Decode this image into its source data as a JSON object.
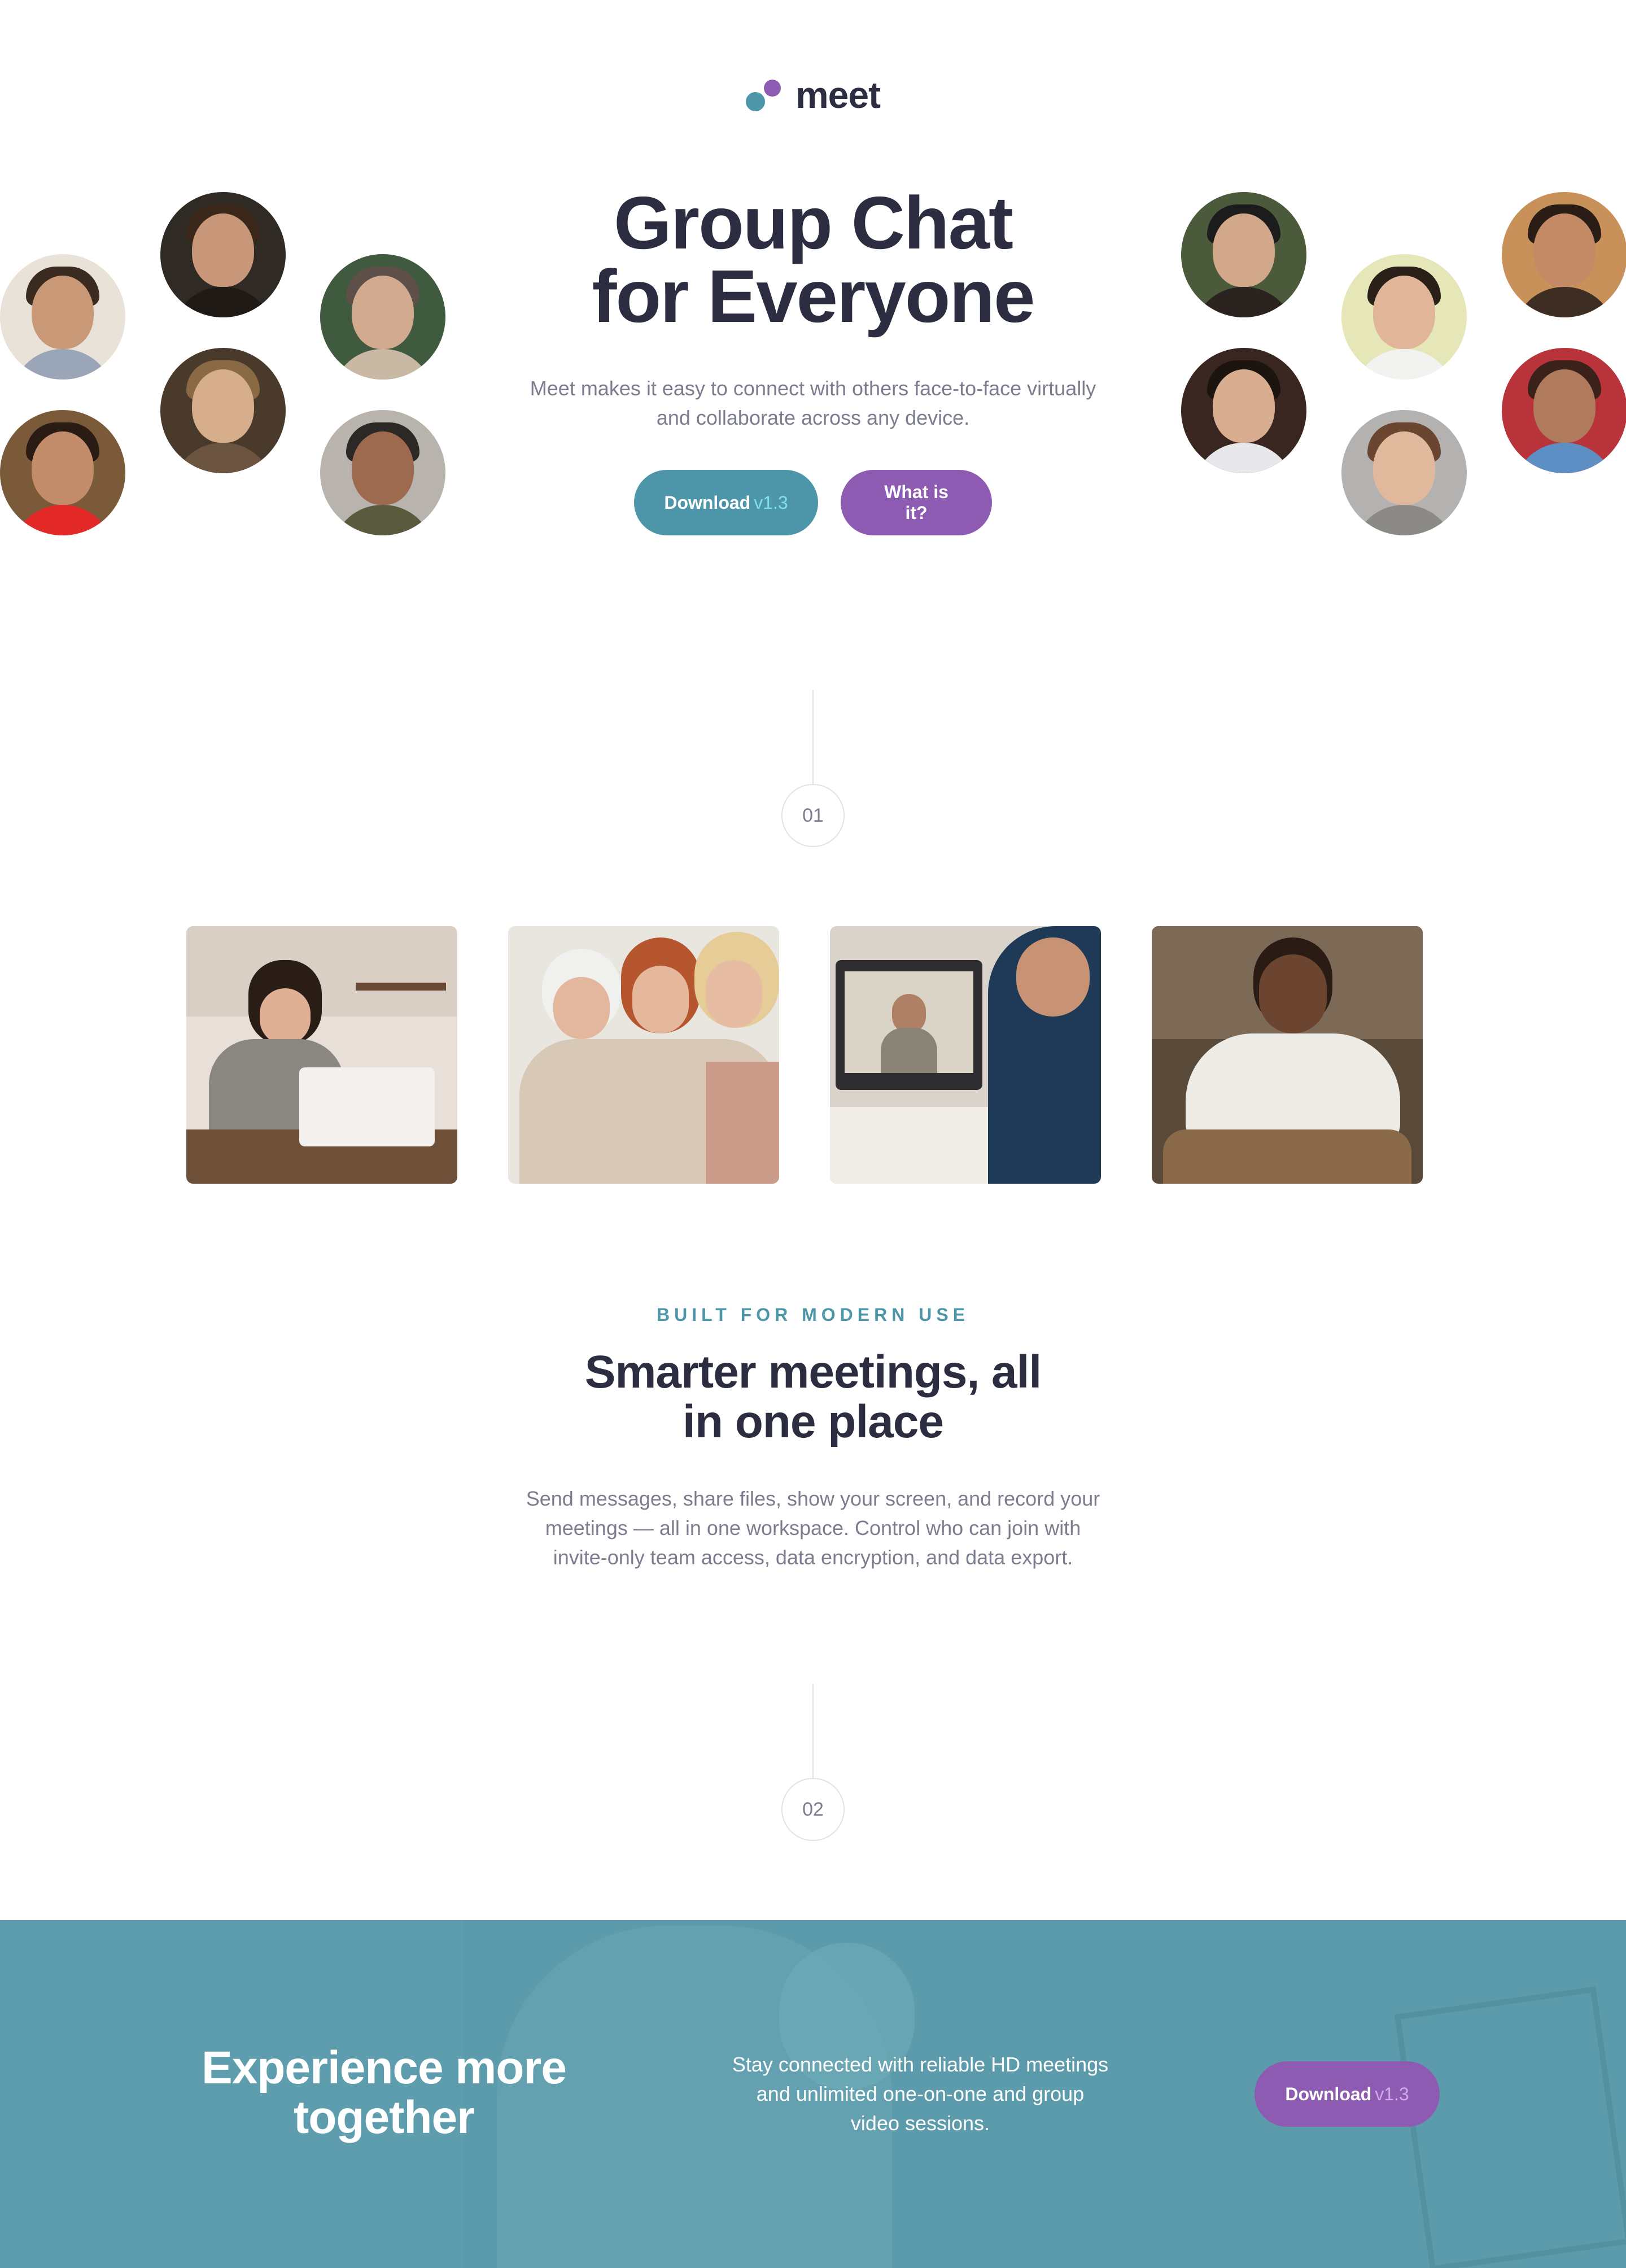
{
  "brand": {
    "name": "meet"
  },
  "hero": {
    "title_line1": "Group Chat",
    "title_line2": "for Everyone",
    "subtitle_line1": "Meet makes it easy to connect with others face-to-face virtually",
    "subtitle_line2": "and collaborate across any device.",
    "download_label": "Download",
    "download_version": "v1.3",
    "what_label": "What is it?"
  },
  "steps": {
    "first": "01",
    "second": "02"
  },
  "feature": {
    "eyebrow": "BUILT FOR MODERN USE",
    "title_line1": "Smarter meetings, all",
    "title_line2": "in one place",
    "body_line1": "Send messages, share files, show your screen, and record your",
    "body_line2": "meetings — all in one workspace. Control who can join with",
    "body_line3": "invite-only team access, data encryption, and data export."
  },
  "cta": {
    "title_line1": "Experience more",
    "title_line2": "together",
    "body_line1": "Stay connected with reliable HD meetings",
    "body_line2": "and unlimited one-on-one and group",
    "body_line3": "video sessions.",
    "download_label": "Download",
    "download_version": "v1.3"
  },
  "colors": {
    "teal": "#4d96a9",
    "purple": "#8d5bb2",
    "navy": "#2c2d40",
    "grey_text": "#7b7c8e",
    "cta_band": "#5b9bab"
  }
}
